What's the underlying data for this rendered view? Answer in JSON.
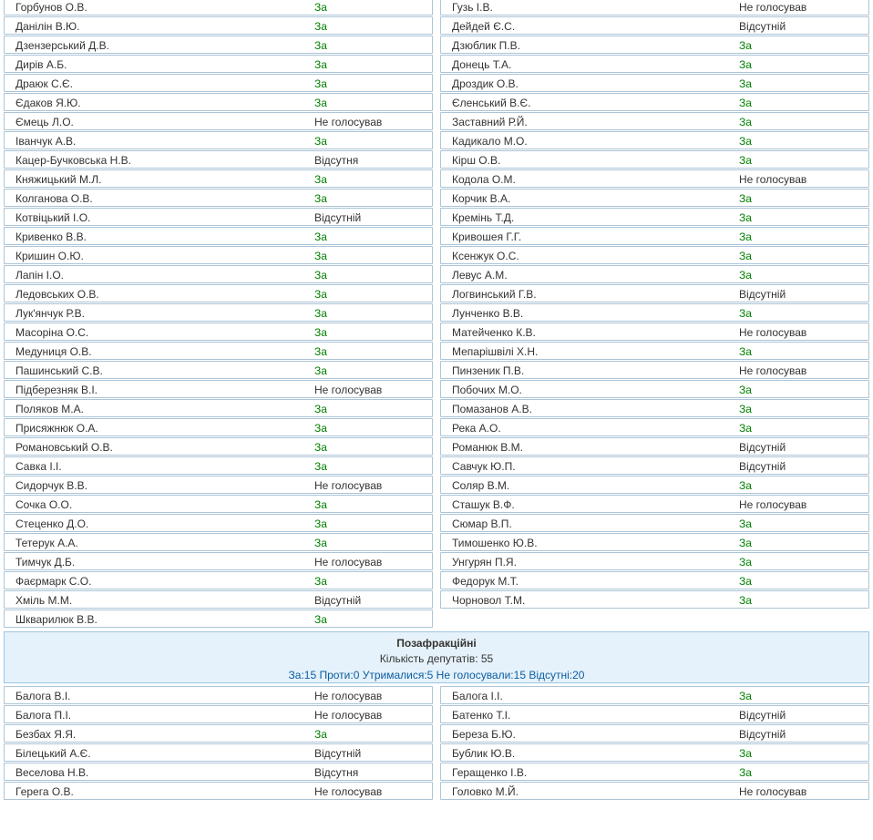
{
  "faction_rows_left": [
    {
      "name": "Горбунов О.В.",
      "vote": "За"
    },
    {
      "name": "Данілін В.Ю.",
      "vote": "За"
    },
    {
      "name": "Дзензерський Д.В.",
      "vote": "За"
    },
    {
      "name": "Дирів А.Б.",
      "vote": "За"
    },
    {
      "name": "Драюк С.Є.",
      "vote": "За"
    },
    {
      "name": "Єдаков Я.Ю.",
      "vote": "За"
    },
    {
      "name": "Ємець Л.О.",
      "vote": "Не голосував"
    },
    {
      "name": "Іванчук А.В.",
      "vote": "За"
    },
    {
      "name": "Кацер-Бучковська Н.В.",
      "vote": "Відсутня"
    },
    {
      "name": "Княжицький М.Л.",
      "vote": "За"
    },
    {
      "name": "Колганова О.В.",
      "vote": "За"
    },
    {
      "name": "Котвіцький І.О.",
      "vote": "Відсутній"
    },
    {
      "name": "Кривенко В.В.",
      "vote": "За"
    },
    {
      "name": "Кришин О.Ю.",
      "vote": "За"
    },
    {
      "name": "Лапін І.О.",
      "vote": "За"
    },
    {
      "name": "Ледовських О.В.",
      "vote": "За"
    },
    {
      "name": "Лук'янчук Р.В.",
      "vote": "За"
    },
    {
      "name": "Масоріна О.С.",
      "vote": "За"
    },
    {
      "name": "Медуниця О.В.",
      "vote": "За"
    },
    {
      "name": "Пашинський С.В.",
      "vote": "За"
    },
    {
      "name": "Підберезняк В.І.",
      "vote": "Не голосував"
    },
    {
      "name": "Поляков М.А.",
      "vote": "За"
    },
    {
      "name": "Присяжнюк О.А.",
      "vote": "За"
    },
    {
      "name": "Романовський О.В.",
      "vote": "За"
    },
    {
      "name": "Савка І.І.",
      "vote": "За"
    },
    {
      "name": "Сидорчук В.В.",
      "vote": "Не голосував"
    },
    {
      "name": "Сочка О.О.",
      "vote": "За"
    },
    {
      "name": "Стеценко Д.О.",
      "vote": "За"
    },
    {
      "name": "Тетерук А.А.",
      "vote": "За"
    },
    {
      "name": "Тимчук Д.Б.",
      "vote": "Не голосував"
    },
    {
      "name": "Фаєрмарк С.О.",
      "vote": "За"
    },
    {
      "name": "Хміль М.М.",
      "vote": "Відсутній"
    },
    {
      "name": "Шкварилюк В.В.",
      "vote": "За"
    }
  ],
  "faction_rows_right": [
    {
      "name": "Гузь І.В.",
      "vote": "Не голосував"
    },
    {
      "name": "Дейдей Є.С.",
      "vote": "Відсутній"
    },
    {
      "name": "Дзюблик П.В.",
      "vote": "За"
    },
    {
      "name": "Донець Т.А.",
      "vote": "За"
    },
    {
      "name": "Дроздик О.В.",
      "vote": "За"
    },
    {
      "name": "Єленський В.Є.",
      "vote": "За"
    },
    {
      "name": "Заставний Р.Й.",
      "vote": "За"
    },
    {
      "name": "Кадикало М.О.",
      "vote": "За"
    },
    {
      "name": "Кірш О.В.",
      "vote": "За"
    },
    {
      "name": "Кодола О.М.",
      "vote": "Не голосував"
    },
    {
      "name": "Корчик В.А.",
      "vote": "За"
    },
    {
      "name": "Кремінь Т.Д.",
      "vote": "За"
    },
    {
      "name": "Кривошея Г.Г.",
      "vote": "За"
    },
    {
      "name": "Ксенжук О.С.",
      "vote": "За"
    },
    {
      "name": "Левус А.М.",
      "vote": "За"
    },
    {
      "name": "Логвинський Г.В.",
      "vote": "Відсутній"
    },
    {
      "name": "Лунченко В.В.",
      "vote": "За"
    },
    {
      "name": "Матейченко К.В.",
      "vote": "Не голосував"
    },
    {
      "name": "Мепарішвілі Х.Н.",
      "vote": "За"
    },
    {
      "name": "Пинзеник П.В.",
      "vote": "Не голосував"
    },
    {
      "name": "Побочих М.О.",
      "vote": "За"
    },
    {
      "name": "Помазанов А.В.",
      "vote": "За"
    },
    {
      "name": "Река А.О.",
      "vote": "За"
    },
    {
      "name": "Романюк В.М.",
      "vote": "Відсутній"
    },
    {
      "name": "Савчук Ю.П.",
      "vote": "Відсутній"
    },
    {
      "name": "Соляр В.М.",
      "vote": "За"
    },
    {
      "name": "Сташук В.Ф.",
      "vote": "Не голосував"
    },
    {
      "name": "Сюмар В.П.",
      "vote": "За"
    },
    {
      "name": "Тимошенко Ю.В.",
      "vote": "За"
    },
    {
      "name": "Унгурян П.Я.",
      "vote": "За"
    },
    {
      "name": "Федорук М.Т.",
      "vote": "За"
    },
    {
      "name": "Чорновол Т.М.",
      "vote": "За"
    }
  ],
  "group": {
    "title": "Позафракційні",
    "count": "Кількість депутатів: 55",
    "summary": "За:15 Проти:0 Утрималися:5 Не голосували:15 Відсутні:20"
  },
  "nonfaction_rows_left": [
    {
      "name": "Балога В.І.",
      "vote": "Не голосував"
    },
    {
      "name": "Балога П.І.",
      "vote": "Не голосував"
    },
    {
      "name": "Безбах Я.Я.",
      "vote": "За"
    },
    {
      "name": "Білецький А.Є.",
      "vote": "Відсутній"
    },
    {
      "name": "Веселова Н.В.",
      "vote": "Відсутня"
    },
    {
      "name": "Герега О.В.",
      "vote": "Не голосував"
    }
  ],
  "nonfaction_rows_right": [
    {
      "name": "Балога І.І.",
      "vote": "За"
    },
    {
      "name": "Батенко Т.І.",
      "vote": "Відсутній"
    },
    {
      "name": "Береза Б.Ю.",
      "vote": "Відсутній"
    },
    {
      "name": "Бублик Ю.В.",
      "vote": "За"
    },
    {
      "name": "Геращенко І.В.",
      "vote": "За"
    },
    {
      "name": "Головко М.Й.",
      "vote": "Не голосував"
    }
  ],
  "colors": {
    "yes": "#008000",
    "summary": "#0b5da2",
    "border": "#acc4d6",
    "group_bg": "#e6f2fb"
  }
}
